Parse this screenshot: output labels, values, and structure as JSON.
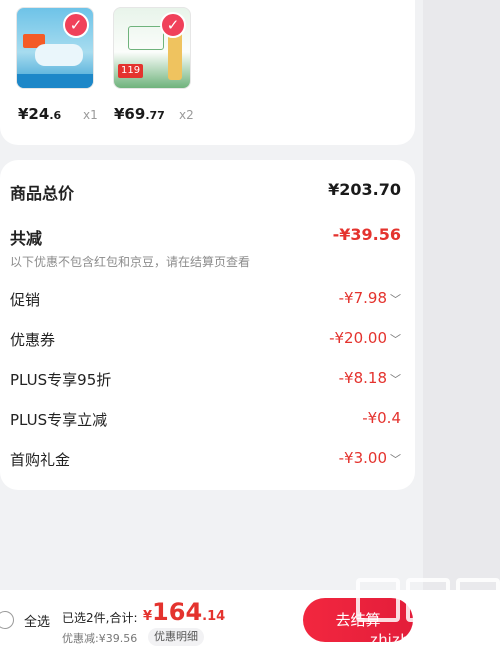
{
  "products": [
    {
      "price_int": "¥24",
      "price_dec": ".6",
      "qty": "x1"
    },
    {
      "price_int": "¥69",
      "price_dec": ".77",
      "qty": "x2"
    }
  ],
  "summary": {
    "total_label": "商品总价",
    "total_value": "¥203.70",
    "reduce_label": "共减",
    "reduce_value": "-¥39.56",
    "note": "以下优惠不包含红包和京豆，请在结算页查看",
    "items": [
      {
        "label": "促销",
        "value": "-¥7.98"
      },
      {
        "label": "优惠券",
        "value": "-¥20.00"
      },
      {
        "label": "PLUS专享95折",
        "value": "-¥8.18"
      },
      {
        "label": "PLUS专享立减",
        "value": "-¥0.4"
      },
      {
        "label": "首购礼金",
        "value": "-¥3.00"
      }
    ]
  },
  "bottom_bar": {
    "select_all": "全选",
    "selected_text": "已选2件,合计:",
    "total_currency": "¥",
    "total_int": "164",
    "total_dec": ".14",
    "discount_text": "优惠减:¥39.56",
    "detail_button": "优惠明细",
    "checkout_button": "去结算"
  },
  "watermark": {
    "text": "zhizhizhi.com"
  },
  "icons": {
    "check": "check-icon",
    "chevron": "chevron-down-icon",
    "radio": "radio-unchecked-icon"
  },
  "colors": {
    "accent": "#e4332e",
    "checkout": "#f2273f",
    "background": "#f1f2f4"
  }
}
